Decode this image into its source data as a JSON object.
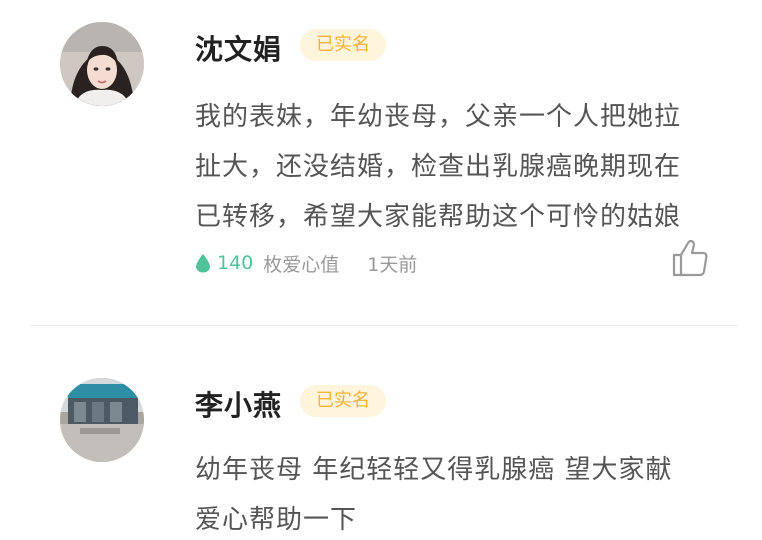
{
  "comments": [
    {
      "name": "沈文娟",
      "badge": "已实名",
      "lines": [
        "我的表妹，年幼丧母，父亲一个人把她拉",
        "扯大，还没结婚，检查出乳腺癌晚期现在",
        "已转移，希望大家能帮助这个可怜的姑娘"
      ],
      "love_count": "140",
      "love_label": "枚爱心值",
      "time": "1天前"
    },
    {
      "name": "李小燕",
      "badge": "已实名",
      "lines": [
        "幼年丧母 年纪轻轻又得乳腺癌 望大家献",
        "爱心帮助一下"
      ]
    }
  ],
  "colors": {
    "accent_green": "#4fc49a",
    "badge_bg": "#fff4dc",
    "badge_text": "#f4b23a"
  },
  "icons": {
    "love_drop": "water-drop-icon",
    "like": "thumbs-up-icon"
  }
}
